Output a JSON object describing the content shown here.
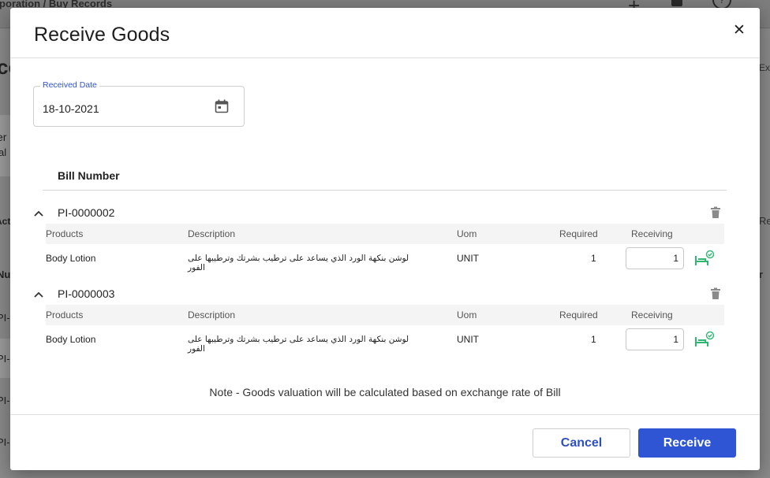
{
  "background": {
    "breadcrumb": "rporation / Buy Records",
    "left_fragments": [
      "co",
      "er",
      "al",
      "Act",
      "Nu",
      "PI-",
      "PI-",
      "PI-",
      "PI-"
    ],
    "right_fragments": [
      "Exp",
      "Re",
      "r"
    ]
  },
  "modal": {
    "title": "Receive Goods",
    "close_icon": "close-icon",
    "received_date": {
      "label": "Received Date",
      "value": "18-10-2021",
      "icon": "calendar-icon"
    },
    "bill_header": "Bill Number",
    "columns": [
      "Products",
      "Description",
      "Uom",
      "Required",
      "Receiving"
    ],
    "bills": [
      {
        "number": "PI-0000002",
        "rows": [
          {
            "product": "Body Lotion",
            "description": "لوشن بنكهة الورد الذي يساعد على ترطيب بشرتك وترطيبها على الفور",
            "uom": "UNIT",
            "required": "1",
            "receiving": "1"
          }
        ]
      },
      {
        "number": "PI-0000003",
        "rows": [
          {
            "product": "Body Lotion",
            "description": "لوشن بنكهة الورد الذي يساعد على ترطيب بشرتك وترطيبها على الفور",
            "uom": "UNIT",
            "required": "1",
            "receiving": "1"
          }
        ]
      }
    ],
    "note": "Note - Goods valuation will be calculated based on exchange rate of Bill",
    "buttons": {
      "cancel": "Cancel",
      "receive": "Receive"
    },
    "colors": {
      "primary": "#2f55d4",
      "receive_icon": "#2eb872"
    }
  }
}
